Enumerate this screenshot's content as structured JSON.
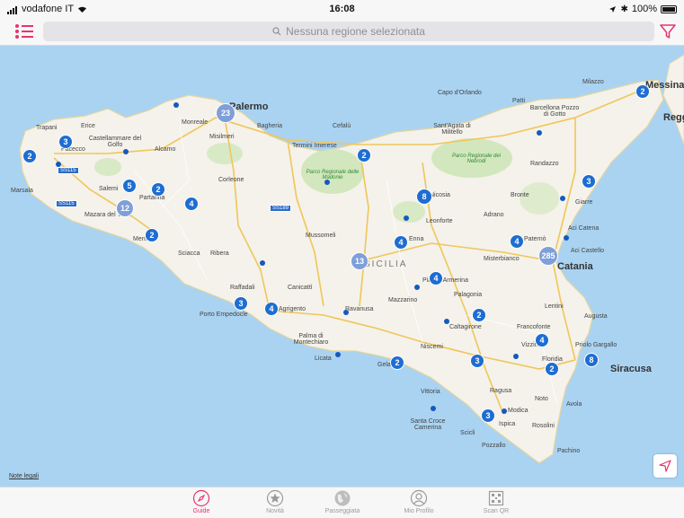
{
  "status": {
    "carrier": "vodafone IT",
    "time": "16:08",
    "battery": "100%"
  },
  "topbar": {
    "search_placeholder": "Nessuna regione selezionata"
  },
  "map": {
    "legal_label": "Note legali",
    "places": [
      {
        "label": "Palermo",
        "cls": "city"
      },
      {
        "label": "Catania",
        "cls": "city"
      },
      {
        "label": "Siracusa",
        "cls": "city"
      },
      {
        "label": "Messina",
        "cls": "city"
      },
      {
        "label": "Regg",
        "cls": "city"
      },
      {
        "label": "Trapani",
        "cls": ""
      },
      {
        "label": "Erice",
        "cls": ""
      },
      {
        "label": "Marsala",
        "cls": ""
      },
      {
        "label": "Castellammare del Golfo",
        "cls": ""
      },
      {
        "label": "Pacecco",
        "cls": ""
      },
      {
        "label": "Alcamo",
        "cls": ""
      },
      {
        "label": "Monreale",
        "cls": ""
      },
      {
        "label": "Misilmeri",
        "cls": ""
      },
      {
        "label": "Bagheria",
        "cls": ""
      },
      {
        "label": "Termini Imerese",
        "cls": ""
      },
      {
        "label": "Cefalù",
        "cls": ""
      },
      {
        "label": "Salemi",
        "cls": ""
      },
      {
        "label": "Partanna",
        "cls": ""
      },
      {
        "label": "Corleone",
        "cls": ""
      },
      {
        "label": "Mazara del Vallo",
        "cls": ""
      },
      {
        "label": "Menfi",
        "cls": ""
      },
      {
        "label": "Sciacca",
        "cls": ""
      },
      {
        "label": "Ribera",
        "cls": ""
      },
      {
        "label": "Raffadali",
        "cls": ""
      },
      {
        "label": "Porto Empedocle",
        "cls": ""
      },
      {
        "label": "Agrigento",
        "cls": ""
      },
      {
        "label": "Palma di Montechiaro",
        "cls": ""
      },
      {
        "label": "Licata",
        "cls": ""
      },
      {
        "label": "Canicattì",
        "cls": ""
      },
      {
        "label": "Ravanusa",
        "cls": ""
      },
      {
        "label": "Mussomeli",
        "cls": ""
      },
      {
        "label": "SICILIA",
        "cls": ""
      },
      {
        "label": "Mazzarino",
        "cls": ""
      },
      {
        "label": "Piazza Armerina",
        "cls": ""
      },
      {
        "label": "Palagonia",
        "cls": ""
      },
      {
        "label": "Caltagirone",
        "cls": ""
      },
      {
        "label": "Niscemi",
        "cls": ""
      },
      {
        "label": "Gela",
        "cls": ""
      },
      {
        "label": "Vittoria",
        "cls": ""
      },
      {
        "label": "Ragusa",
        "cls": ""
      },
      {
        "label": "Modica",
        "cls": ""
      },
      {
        "label": "Ispica",
        "cls": ""
      },
      {
        "label": "Rosolini",
        "cls": ""
      },
      {
        "label": "Santa Croce Camerina",
        "cls": ""
      },
      {
        "label": "Scicli",
        "cls": ""
      },
      {
        "label": "Pozzallo",
        "cls": ""
      },
      {
        "label": "Pachino",
        "cls": ""
      },
      {
        "label": "Noto",
        "cls": ""
      },
      {
        "label": "Avola",
        "cls": ""
      },
      {
        "label": "Floridia",
        "cls": ""
      },
      {
        "label": "Priolo Gargallo",
        "cls": ""
      },
      {
        "label": "Augusta",
        "cls": ""
      },
      {
        "label": "Lentini",
        "cls": ""
      },
      {
        "label": "Francofonte",
        "cls": ""
      },
      {
        "label": "Vizzini",
        "cls": ""
      },
      {
        "label": "Misterbianco",
        "cls": ""
      },
      {
        "label": "Aci Castello",
        "cls": ""
      },
      {
        "label": "Aci Catena",
        "cls": ""
      },
      {
        "label": "Paternò",
        "cls": ""
      },
      {
        "label": "Adrano",
        "cls": ""
      },
      {
        "label": "Bronte",
        "cls": ""
      },
      {
        "label": "Giarre",
        "cls": ""
      },
      {
        "label": "Randazzo",
        "cls": ""
      },
      {
        "label": "Leonforte",
        "cls": ""
      },
      {
        "label": "Nicosia",
        "cls": ""
      },
      {
        "label": "Enna",
        "cls": ""
      },
      {
        "label": "Capo d'Orlando",
        "cls": ""
      },
      {
        "label": "Patti",
        "cls": ""
      },
      {
        "label": "Barcellona Pozzo di Gotto",
        "cls": ""
      },
      {
        "label": "Milazzo",
        "cls": ""
      },
      {
        "label": "Sant'Agata di Militello",
        "cls": ""
      },
      {
        "label": "Parco Regionale delle Madonie",
        "cls": "park"
      },
      {
        "label": "Parco Regionale dei Nebrodi",
        "cls": "park"
      }
    ],
    "road_labels": [
      "SS115",
      "SS115",
      "SS189"
    ],
    "clusters": [
      {
        "count": "23",
        "big": true
      },
      {
        "count": "2"
      },
      {
        "count": "3"
      },
      {
        "count": "2"
      },
      {
        "count": "5"
      },
      {
        "count": "2"
      },
      {
        "count": "12",
        "big": true
      },
      {
        "count": "4"
      },
      {
        "count": "2"
      },
      {
        "count": "8"
      },
      {
        "count": "4"
      },
      {
        "count": "13",
        "big": true
      },
      {
        "count": "4"
      },
      {
        "count": "3"
      },
      {
        "count": "4"
      },
      {
        "count": "2"
      },
      {
        "count": "2"
      },
      {
        "count": "3"
      },
      {
        "count": "3"
      },
      {
        "count": "4"
      },
      {
        "count": "2"
      },
      {
        "count": "8"
      },
      {
        "count": "4"
      },
      {
        "count": "285",
        "big": true
      },
      {
        "count": "3"
      },
      {
        "count": "2"
      }
    ]
  },
  "tabs": [
    {
      "label": "Guide",
      "icon": "compass-icon",
      "active": true
    },
    {
      "label": "Novità",
      "icon": "star-icon"
    },
    {
      "label": "Passeggiata",
      "icon": "globe-icon"
    },
    {
      "label": "Mio Profilo",
      "icon": "profile-icon"
    },
    {
      "label": "Scan QR",
      "icon": "qr-icon"
    }
  ],
  "colors": {
    "accent": "#e5346e",
    "sea": "#aad3f2",
    "land": "#f4f2ea",
    "marker": "#1e6dd2"
  }
}
